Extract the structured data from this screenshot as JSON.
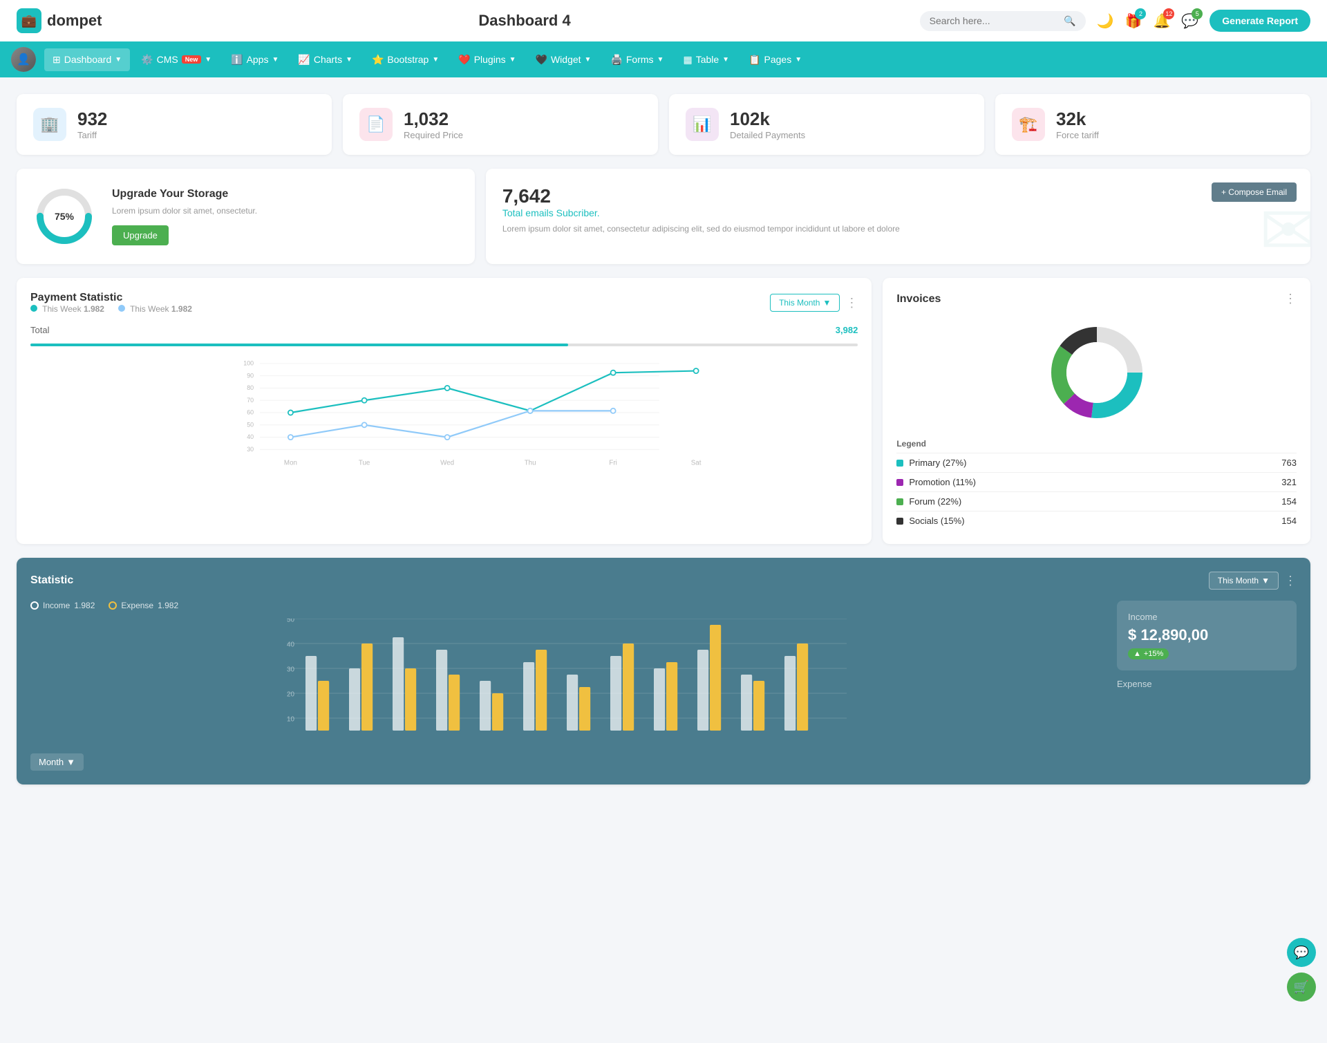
{
  "header": {
    "logo_text": "dompet",
    "page_title": "Dashboard 4",
    "search_placeholder": "Search here...",
    "btn_generate": "Generate Report",
    "icons": {
      "gift_badge": "2",
      "bell_badge": "12",
      "chat_badge": "5"
    }
  },
  "navbar": {
    "items": [
      {
        "label": "Dashboard",
        "active": true,
        "has_arrow": true
      },
      {
        "label": "CMS",
        "active": false,
        "has_arrow": true,
        "badge_new": true
      },
      {
        "label": "Apps",
        "active": false,
        "has_arrow": true
      },
      {
        "label": "Charts",
        "active": false,
        "has_arrow": true
      },
      {
        "label": "Bootstrap",
        "active": false,
        "has_arrow": true
      },
      {
        "label": "Plugins",
        "active": false,
        "has_arrow": true
      },
      {
        "label": "Widget",
        "active": false,
        "has_arrow": true
      },
      {
        "label": "Forms",
        "active": false,
        "has_arrow": true
      },
      {
        "label": "Table",
        "active": false,
        "has_arrow": true
      },
      {
        "label": "Pages",
        "active": false,
        "has_arrow": true
      }
    ]
  },
  "stat_cards": [
    {
      "value": "932",
      "label": "Tariff",
      "icon": "🏢",
      "icon_class": "stat-icon-blue"
    },
    {
      "value": "1,032",
      "label": "Required Price",
      "icon": "📄",
      "icon_class": "stat-icon-red"
    },
    {
      "value": "102k",
      "label": "Detailed Payments",
      "icon": "📊",
      "icon_class": "stat-icon-purple"
    },
    {
      "value": "32k",
      "label": "Force tariff",
      "icon": "🏗️",
      "icon_class": "stat-icon-pink"
    }
  ],
  "storage": {
    "percent": "75%",
    "title": "Upgrade Your Storage",
    "desc": "Lorem ipsum dolor sit amet, onsectetur.",
    "btn_label": "Upgrade"
  },
  "email": {
    "count": "7,642",
    "subtitle": "Total emails Subcriber.",
    "desc": "Lorem ipsum dolor sit amet, consectetur adipiscing elit, sed do eiusmod tempor incididunt ut labore et dolore",
    "btn_compose": "+ Compose Email"
  },
  "payment_chart": {
    "title": "Payment Statistic",
    "legend1_label": "This Week",
    "legend1_value": "1.982",
    "legend2_label": "This Week",
    "legend2_value": "1.982",
    "filter_label": "This Month",
    "total_label": "Total",
    "total_value": "3,982",
    "progress_pct": 65,
    "x_labels": [
      "Mon",
      "Tue",
      "Wed",
      "Thu",
      "Fri",
      "Sat"
    ],
    "y_labels": [
      "100",
      "90",
      "80",
      "70",
      "60",
      "50",
      "40",
      "30"
    ]
  },
  "invoices": {
    "title": "Invoices",
    "legend": [
      {
        "label": "Primary (27%)",
        "value": "763",
        "color": "#1cbfbf"
      },
      {
        "label": "Promotion (11%)",
        "value": "321",
        "color": "#9c27b0"
      },
      {
        "label": "Forum (22%)",
        "value": "154",
        "color": "#4caf50"
      },
      {
        "label": "Socials (15%)",
        "value": "154",
        "color": "#333"
      }
    ]
  },
  "statistic_bar": {
    "title": "Statistic",
    "filter_label": "This Month",
    "income_label": "Income",
    "income_legend_value": "1.982",
    "expense_label": "Expense",
    "expense_legend_value": "1.982",
    "income_section_label": "Income",
    "income_value": "$ 12,890,00",
    "income_badge": "+15%",
    "expense_section_label": "Expense",
    "month_label": "Month"
  }
}
